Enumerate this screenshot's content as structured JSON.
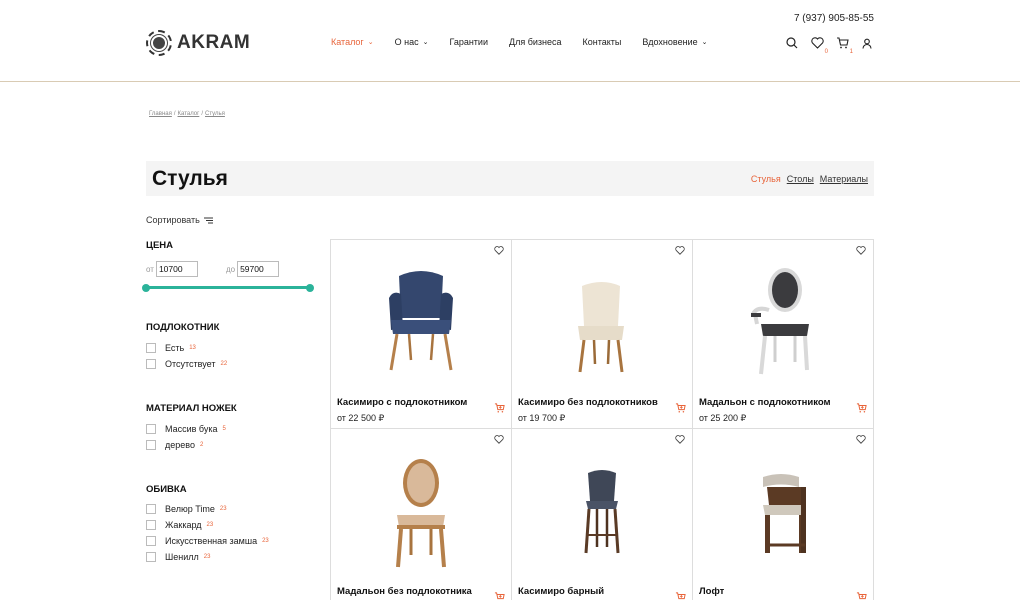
{
  "header": {
    "phone": "7 (937) 905-85-55",
    "logo": "AKRAM",
    "nav": [
      {
        "label": "Каталог",
        "dropdown": true,
        "active": true
      },
      {
        "label": "О нас",
        "dropdown": true
      },
      {
        "label": "Гарантии",
        "dropdown": false
      },
      {
        "label": "Для бизнеса",
        "dropdown": false
      },
      {
        "label": "Контакты",
        "dropdown": false
      },
      {
        "label": "Вдохновение",
        "dropdown": true
      }
    ],
    "favorites_count": "0",
    "cart_count": "1",
    "accent_color": "#e8643a"
  },
  "breadcrumb": [
    "Главная",
    "Каталог",
    "Стулья"
  ],
  "page_title": "Стулья",
  "categories": [
    "Стулья",
    "Столы",
    "Материалы"
  ],
  "sort_label": "Сортировать",
  "filters": {
    "price": {
      "title": "ЦЕНА",
      "from_label": "от",
      "from": "10700",
      "to_label": "до",
      "to": "59700",
      "slider_color": "#2bb39a",
      "range_fraction": [
        0,
        1
      ]
    },
    "armrest": {
      "title": "ПОДЛОКОТНИК",
      "options": [
        {
          "label": "Есть",
          "count": "13"
        },
        {
          "label": "Отсутствует",
          "count": "22"
        }
      ]
    },
    "legs": {
      "title": "МАТЕРИАЛ НОЖЕК",
      "options": [
        {
          "label": "Массив бука",
          "count": "5"
        },
        {
          "label": "дерево",
          "count": "2"
        }
      ]
    },
    "upholstery": {
      "title": "ОБИВКА",
      "options": [
        {
          "label": "Велюр Time",
          "count": "23"
        },
        {
          "label": "Жаккард",
          "count": "23"
        },
        {
          "label": "Искусственная замша",
          "count": "23"
        },
        {
          "label": "Шенилл",
          "count": "23"
        }
      ]
    }
  },
  "products": [
    {
      "name": "Касимиро с подлокотником",
      "price": "от 22 500 ₽"
    },
    {
      "name": "Касимиро без подлокотников",
      "price": "от 19 700 ₽"
    },
    {
      "name": "Мадальон с подлокотником",
      "price": "от 25 200 ₽"
    },
    {
      "name": "Мадальон без подлокотника",
      "price": ""
    },
    {
      "name": "Касимиро барный",
      "price": ""
    },
    {
      "name": "Лофт",
      "price": ""
    }
  ]
}
